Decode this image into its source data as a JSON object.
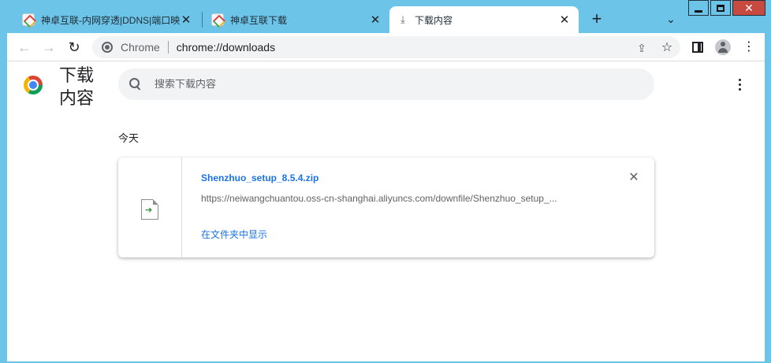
{
  "tabs": [
    {
      "title": "神卓互联-内网穿透|DDNS|端口映射",
      "icon": "shenzhuo-favicon",
      "active": false
    },
    {
      "title": "神卓互联下载",
      "icon": "shenzhuo-favicon",
      "active": false
    },
    {
      "title": "下载内容",
      "icon": "download-icon",
      "active": true
    }
  ],
  "tab_close_glyph": "✕",
  "new_tab_glyph": "+",
  "toolbar": {
    "back": "←",
    "forward": "→",
    "reload": "↻",
    "omnibox_label": "Chrome",
    "url": "chrome://downloads",
    "share": "⇪",
    "bookmark": "☆"
  },
  "page": {
    "title": "下载内容",
    "search_placeholder": "搜索下载内容",
    "date_header": "今天"
  },
  "downloads": [
    {
      "file_name": "Shenzhuo_setup_8.5.4.zip",
      "url": "https://neiwangchuantou.oss-cn-shanghai.aliyuncs.com/downfile/Shenzhuo_setup_...",
      "action": "在文件夹中显示"
    }
  ],
  "colors": {
    "frame": "#6cc5e9",
    "link": "#1a73e8",
    "close_button": "#c74a41"
  }
}
